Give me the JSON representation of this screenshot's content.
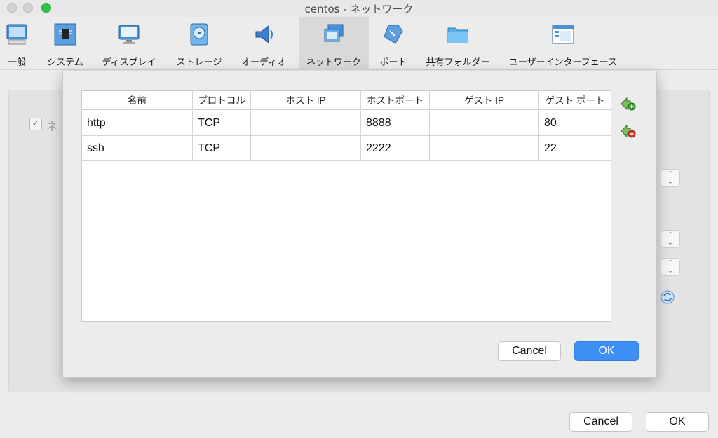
{
  "window": {
    "title": "centos - ネットワーク"
  },
  "toolbar": {
    "items": [
      {
        "label": "一般",
        "icon": "general-icon"
      },
      {
        "label": "システム",
        "icon": "system-icon"
      },
      {
        "label": "ディスプレイ",
        "icon": "display-icon"
      },
      {
        "label": "ストレージ",
        "icon": "storage-icon"
      },
      {
        "label": "オーディオ",
        "icon": "audio-icon"
      },
      {
        "label": "ネットワーク",
        "icon": "network-icon",
        "active": true
      },
      {
        "label": "ポート",
        "icon": "ports-icon"
      },
      {
        "label": "共有フォルダー",
        "icon": "shared-folder-icon"
      },
      {
        "label": "ユーザーインターフェース",
        "icon": "user-interface-icon"
      }
    ]
  },
  "background": {
    "checkbox_label": "ネ",
    "cancel_label": "Cancel",
    "ok_label": "OK"
  },
  "dialog": {
    "columns": [
      "名前",
      "プロトコル",
      "ホスト IP",
      "ホストポート",
      "ゲスト IP",
      "ゲスト ポート"
    ],
    "rows": [
      [
        "http",
        "TCP",
        "",
        "8888",
        "",
        "80"
      ],
      [
        "ssh",
        "TCP",
        "",
        "2222",
        "",
        "22"
      ]
    ],
    "cancel_label": "Cancel",
    "ok_label": "OK"
  },
  "colors": {
    "accent": "#3d8ff5",
    "zoom": "#2dc544",
    "add": "#3aa63a",
    "remove": "#d33a2c"
  }
}
